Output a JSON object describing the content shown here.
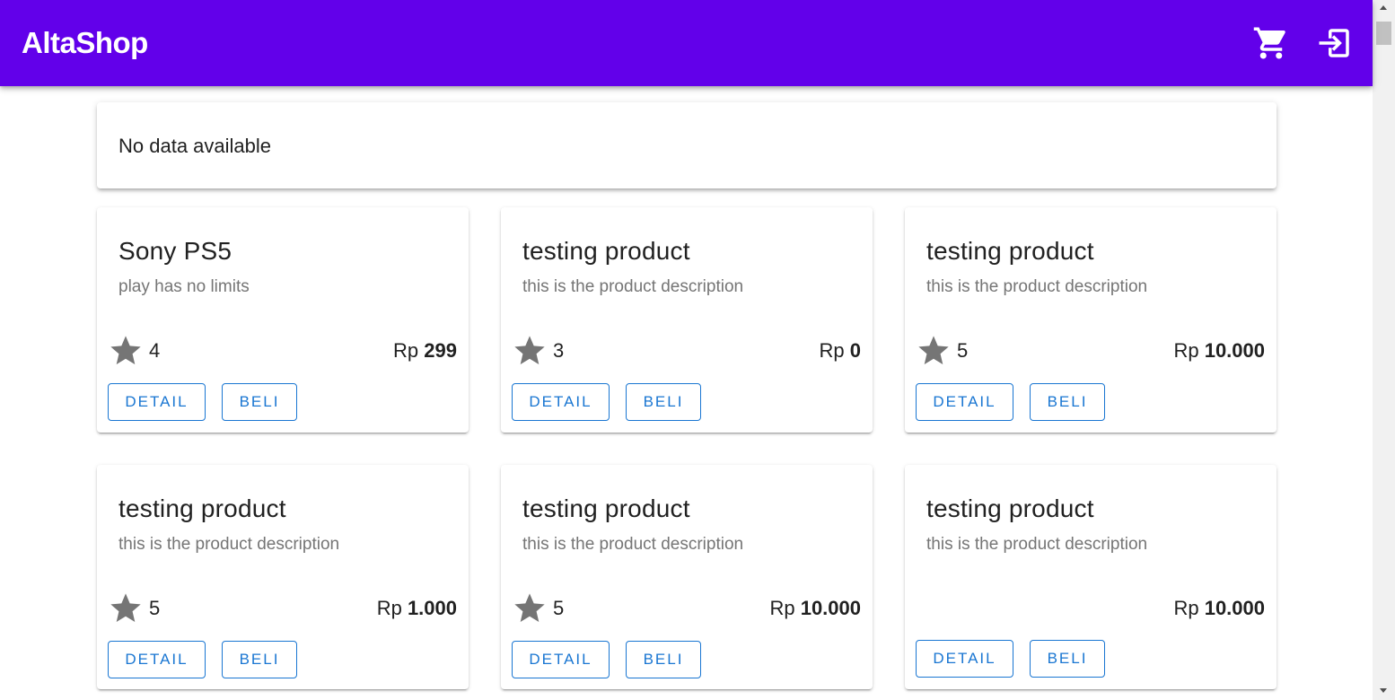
{
  "header": {
    "title": "AltaShop",
    "background": "#6200ea",
    "icons": [
      "cart-icon",
      "login-icon"
    ]
  },
  "notice": {
    "text": "No data available"
  },
  "currency": "Rp",
  "buttons": {
    "detail": "DETAIL",
    "buy": "BELI"
  },
  "products": [
    {
      "name": "Sony PS5",
      "description": "play has no limits",
      "rating": "4",
      "price": "299"
    },
    {
      "name": "testing product",
      "description": "this is the product description",
      "rating": "3",
      "price": "0"
    },
    {
      "name": "testing product",
      "description": "this is the product description",
      "rating": "5",
      "price": "10.000"
    },
    {
      "name": "testing product",
      "description": "this is the product description",
      "rating": "5",
      "price": "1.000"
    },
    {
      "name": "testing product",
      "description": "this is the product description",
      "rating": "5",
      "price": "10.000"
    },
    {
      "name": "testing product",
      "description": "this is the product description",
      "rating": null,
      "price": "10.000"
    }
  ],
  "colors": {
    "accent": "#1976d2",
    "star": "#757575"
  }
}
